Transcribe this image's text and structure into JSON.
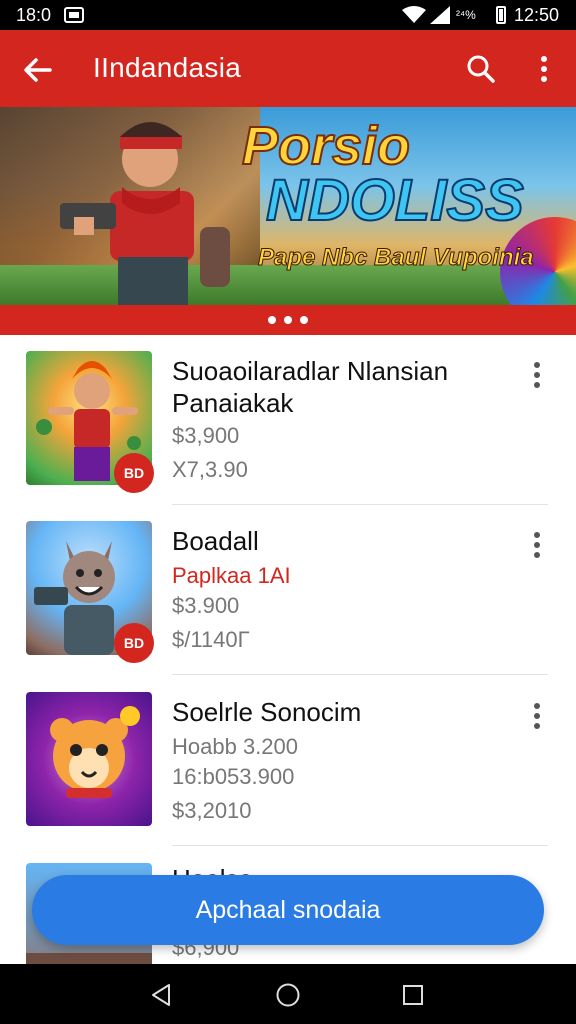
{
  "status_bar": {
    "time": "18:0",
    "misc": "²⁴%",
    "right_time": "12:50"
  },
  "app_bar": {
    "title": "IIndandasia",
    "accent": "#d3261f"
  },
  "banner": {
    "headline_1": "Porsio",
    "headline_2": "NDOLISS",
    "tagline": "Pape Nbc Baul Vupoinia",
    "pager_dots": 3
  },
  "list": [
    {
      "title": "Suoaoilaradlar Nlansian Panaiakak",
      "line_1": "$3,900",
      "line_2": "X7,3.90",
      "badge": "BD",
      "thumb_icon": "hero-character-icon"
    },
    {
      "title": "Boadall",
      "line_1": "Paplkaa 1AI",
      "line_1_style": "red",
      "line_2": "$3.900",
      "line_3": "$/1140Г",
      "badge": "BD",
      "thumb_icon": "wolf-character-icon"
    },
    {
      "title": "Soelrle Sonocim",
      "line_1": "Hoabb 3.200",
      "line_2": "16:b053.900",
      "line_3": "$3,2010",
      "thumb_icon": "hamster-character-icon"
    },
    {
      "title": "Haalsa",
      "line_3": "$6,900",
      "thumb_icon": "game-thumbnail-icon"
    }
  ],
  "fab": {
    "label": "Apchaal snodaia",
    "color": "#2a7be4"
  },
  "nav_bar": {
    "back_icon": "triangle-back-icon",
    "home_icon": "circle-home-icon",
    "recents_icon": "square-recents-icon"
  }
}
